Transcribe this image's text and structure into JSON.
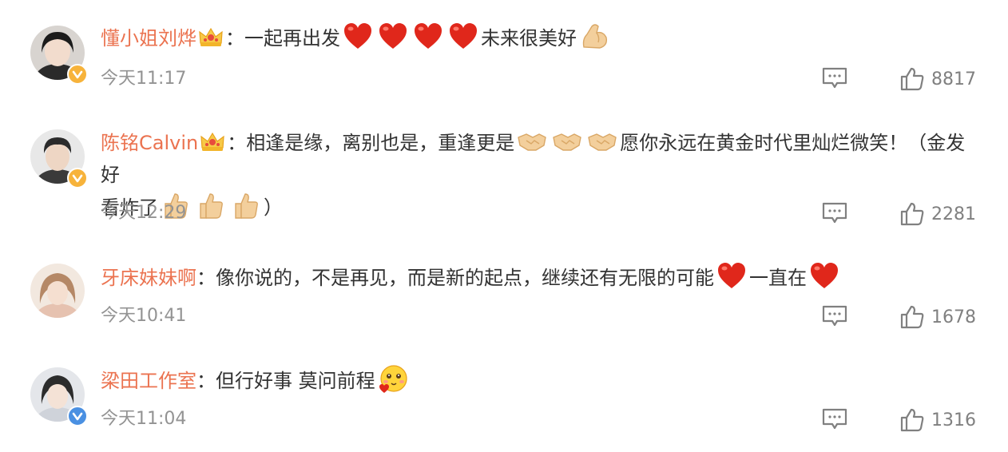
{
  "comments": [
    {
      "username": "懂小姐刘烨",
      "badge_color": "#f7b33b",
      "parts": [
        "：一起再出发",
        "未来很美好"
      ],
      "time": "今天11:17",
      "likes": "8817"
    },
    {
      "username": "陈铭Calvin",
      "badge_color": "#f7b33b",
      "parts": [
        "：相逢是缘，离别也是，重逢更是",
        "愿你永远在黄金时代里灿烂微笑！（金发好",
        "看炸了",
        "）"
      ],
      "time": "今天12:29",
      "likes": "2281"
    },
    {
      "username": "牙床妹妹啊",
      "badge_color": null,
      "parts": [
        "：像你说的，不是再见，而是新的起点，继续还有无限的可能",
        "一直在"
      ],
      "time": "今天10:41",
      "likes": "1678"
    },
    {
      "username": "梁田工作室",
      "badge_color": "#4a90e2",
      "parts": [
        "：但行好事 莫问前程"
      ],
      "time": "今天11:04",
      "likes": "1316"
    }
  ],
  "colors": {
    "username": "#eb7350",
    "text": "#333333",
    "time": "#939393",
    "icon": "#808080"
  }
}
